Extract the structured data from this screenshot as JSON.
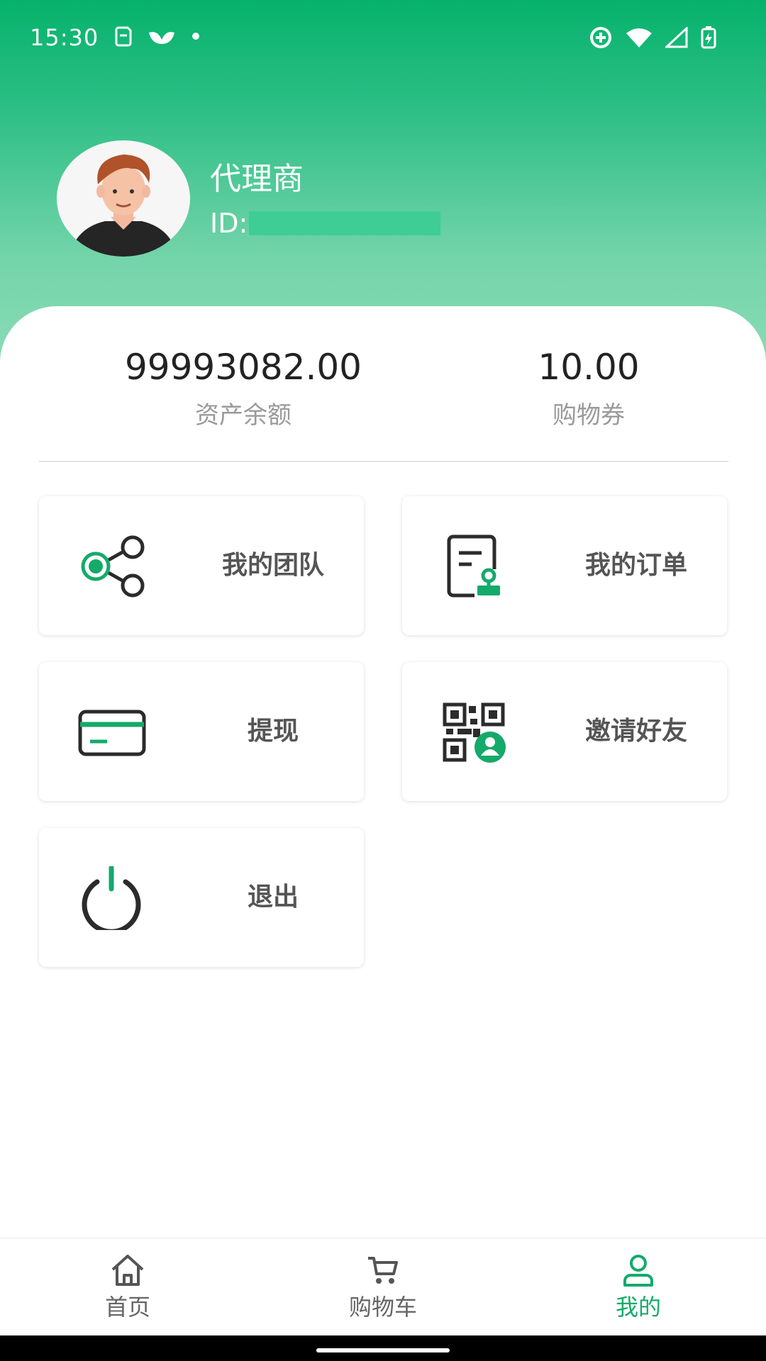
{
  "status_bar": {
    "time": "15:30",
    "left_icons": [
      "sim-icon",
      "app-notification-icon",
      "dot-icon"
    ],
    "right_icons": [
      "data-saver-icon",
      "wifi-icon",
      "signal-icon",
      "battery-charging-icon"
    ]
  },
  "profile": {
    "name": "代理商",
    "id_label": "ID:"
  },
  "stats": {
    "balance_value": "99993082.00",
    "balance_label": "资产余额",
    "coupon_value": "10.00",
    "coupon_label": "购物券"
  },
  "menu": {
    "team": "我的团队",
    "orders": "我的订单",
    "withdraw": "提现",
    "invite": "邀请好友",
    "logout": "退出"
  },
  "nav": {
    "home": "首页",
    "cart": "购物车",
    "mine": "我的"
  },
  "colors": {
    "accent": "#14AA6A",
    "header_top": "#06B26C",
    "header_bottom": "#8ADCB6",
    "tile_label": "#555555"
  }
}
